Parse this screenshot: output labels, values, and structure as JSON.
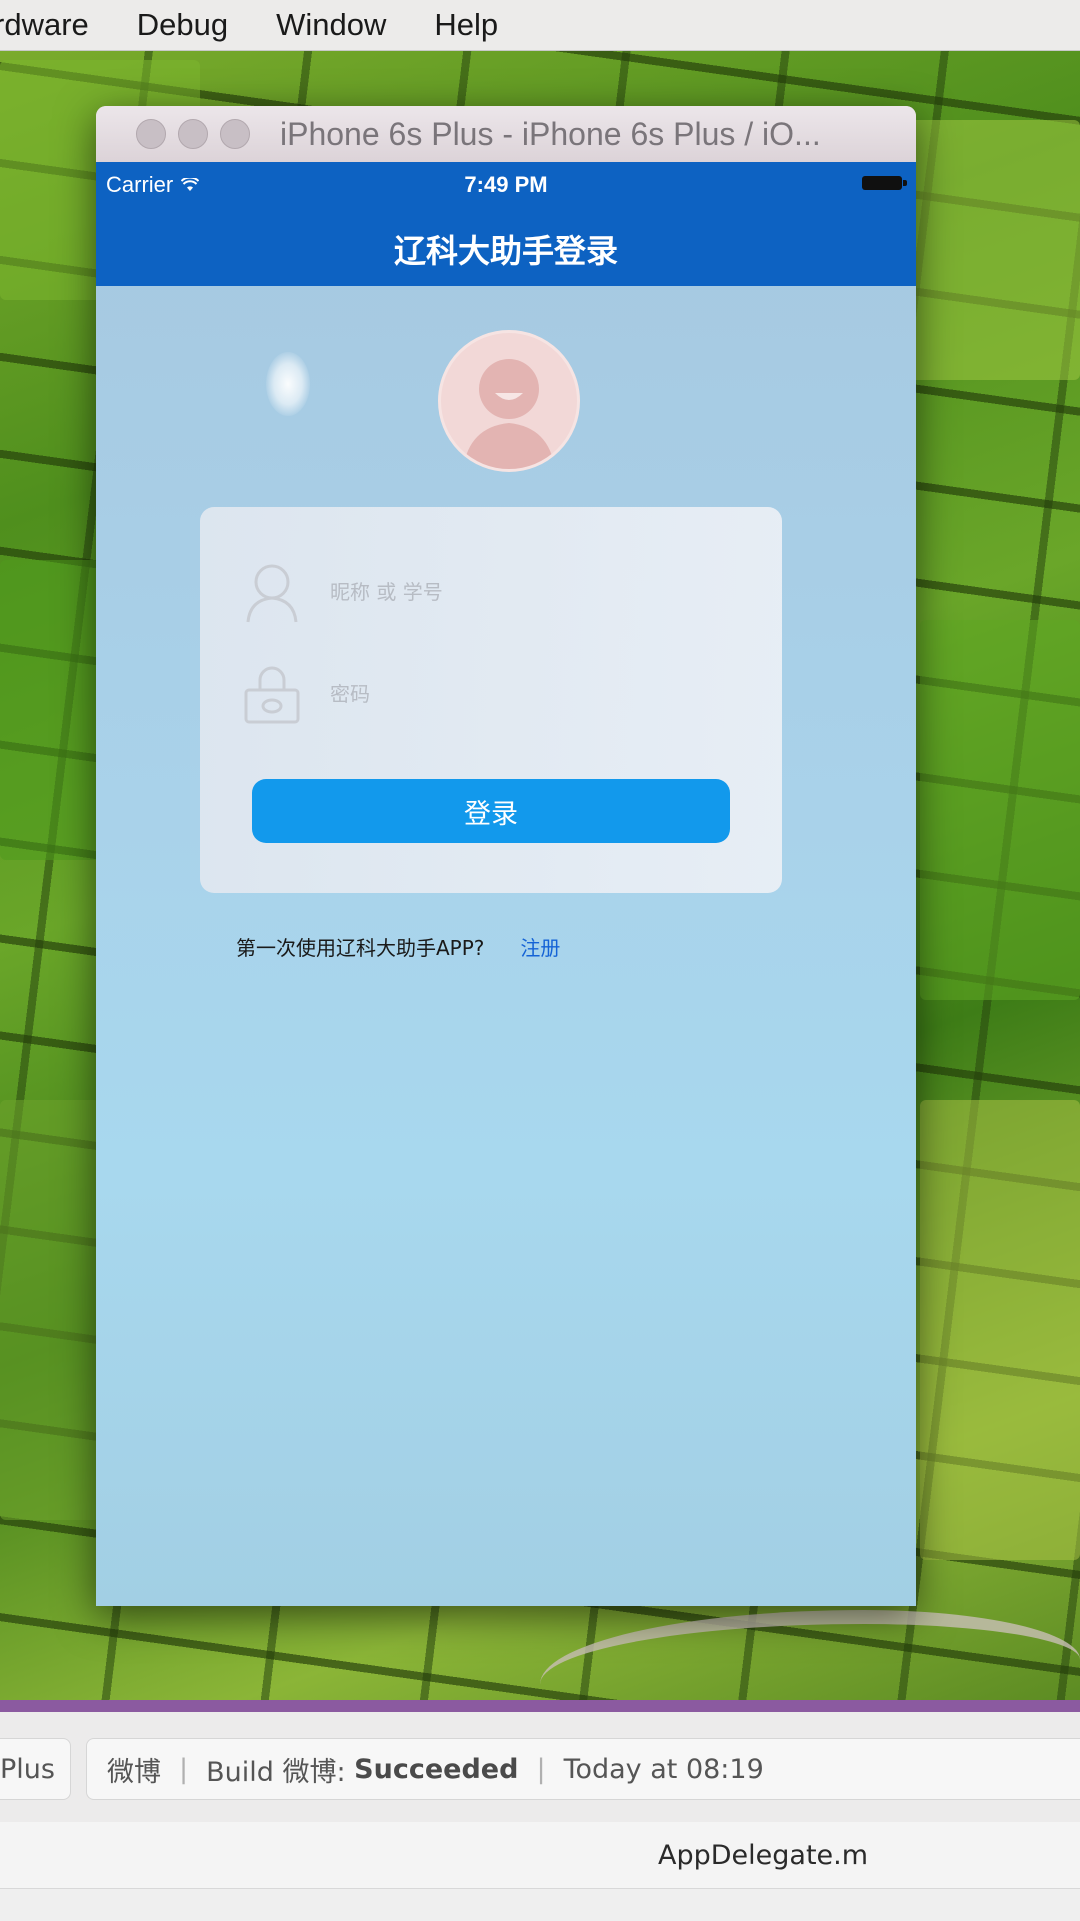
{
  "menubar": {
    "items": [
      "rdware",
      "Debug",
      "Window",
      "Help"
    ]
  },
  "simulator": {
    "window_title": "iPhone 6s Plus - iPhone 6s Plus / iO...",
    "status_bar": {
      "carrier": "Carrier",
      "time": "7:49 PM"
    },
    "nav_title": "辽科大助手登录",
    "login": {
      "username_placeholder": "昵称 或 学号",
      "password_placeholder": "密码",
      "button_label": "登录"
    },
    "register": {
      "prompt": "第一次使用辽科大助手APP?",
      "link": "注册"
    }
  },
  "xcode": {
    "scheme_tail": "Plus",
    "activity": {
      "scheme": "微博",
      "build_prefix": "Build 微博:",
      "build_status": "Succeeded",
      "timestamp": "Today at 08:19"
    },
    "editor_filename": "AppDelegate.m"
  },
  "colors": {
    "nav_bar": "#0d62c2",
    "login_button": "#1299ec",
    "register_link": "#1563d6",
    "screen_background": "#a8d4ea",
    "xcode_accent": "#8b5aa0"
  },
  "icons": {
    "avatar": "default-avatar-icon",
    "username": "user-icon",
    "password": "lock-icon",
    "wifi": "wifi-icon",
    "battery": "battery-icon"
  }
}
